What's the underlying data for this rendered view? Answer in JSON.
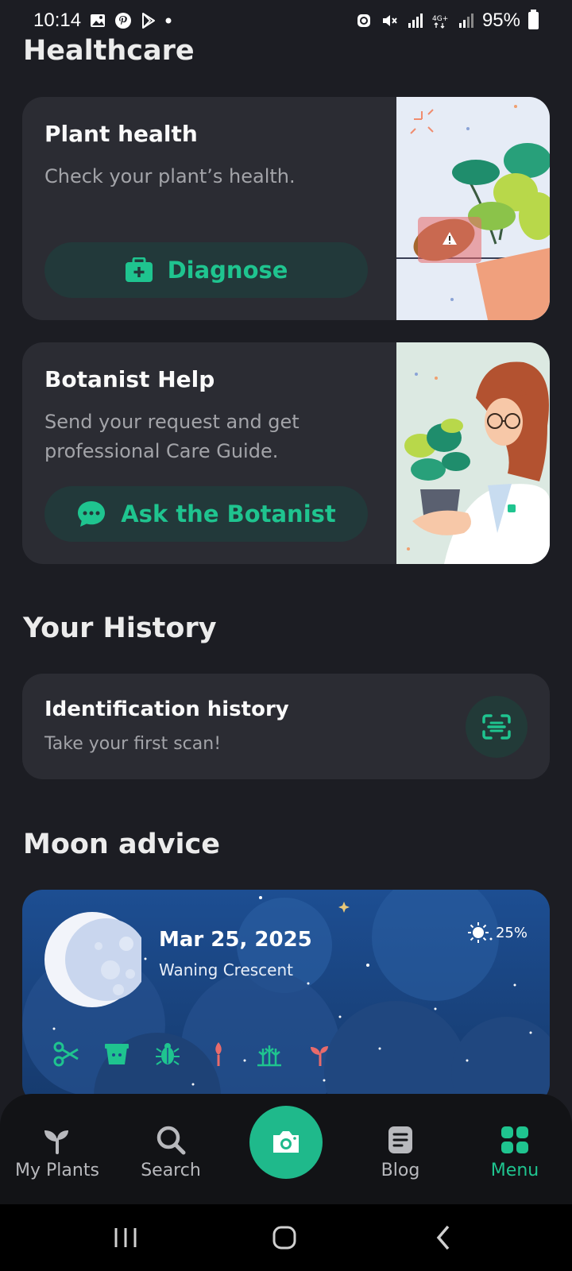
{
  "status_bar": {
    "time": "10:14",
    "battery": "95%",
    "icons_left": [
      "gallery-icon",
      "pinterest-icon",
      "play-store-icon",
      "dot-icon"
    ],
    "icons_right": [
      "eco-icon",
      "mute-icon",
      "signal-r-icon",
      "4g-icon",
      "signal-icon"
    ]
  },
  "healthcare": {
    "title": "Healthcare",
    "plant_health": {
      "title": "Plant health",
      "subtitle": "Check your plant’s health.",
      "button": "Diagnose"
    },
    "botanist": {
      "title": "Botanist Help",
      "subtitle_line1": "Send your request and get",
      "subtitle_line2": "professional Care Guide.",
      "button": "Ask the Botanist"
    }
  },
  "history": {
    "title": "Your History",
    "card_title": "Identification history",
    "card_subtitle": "Take your first scan!"
  },
  "moon": {
    "title": "Moon advice",
    "date": "Mar 25, 2025",
    "phase": "Waning Crescent",
    "illumination": "25%",
    "activity_icons": [
      "scissors-icon",
      "pot-icon",
      "bug-icon",
      "trowel-icon",
      "seedlings-icon",
      "sprout-icon"
    ]
  },
  "bottom_nav": {
    "items": [
      {
        "label": "My Plants",
        "icon": "sprout-icon"
      },
      {
        "label": "Search",
        "icon": "search-icon"
      },
      {
        "label": "",
        "icon": "camera-icon"
      },
      {
        "label": "Blog",
        "icon": "document-icon"
      },
      {
        "label": "Menu",
        "icon": "grid-icon"
      }
    ],
    "active": "Menu"
  },
  "colors": {
    "background": "#1c1d23",
    "card": "#2b2c33",
    "accent": "#1fc48f",
    "moon_card": "#1b4a8a"
  }
}
